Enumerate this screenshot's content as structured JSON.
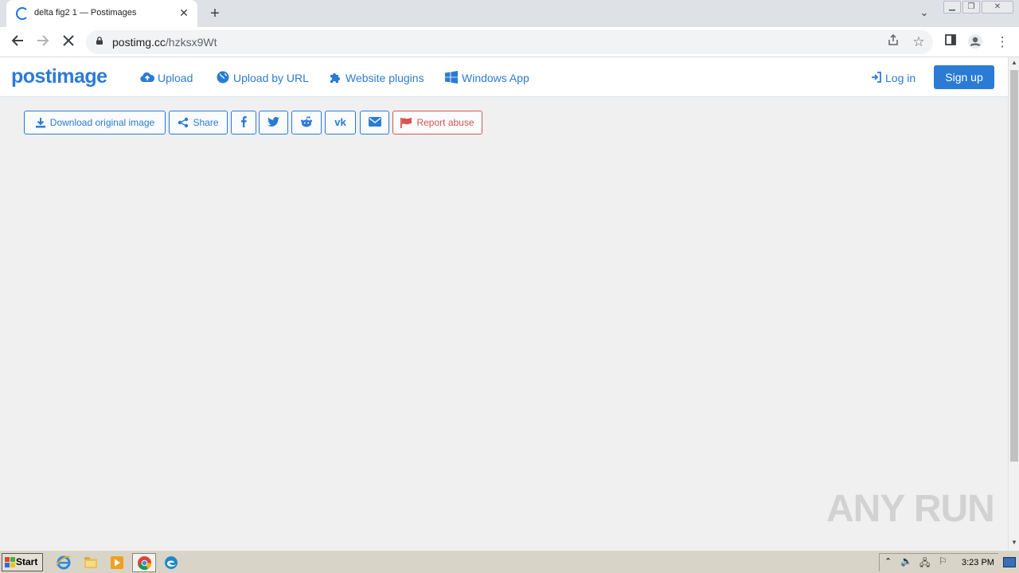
{
  "browser": {
    "tab_title": "delta fig2 1 — Postimages",
    "url_host": "postimg.cc",
    "url_path": "/hzksx9Wt"
  },
  "site": {
    "logo_text": "postimage",
    "nav": {
      "upload": "Upload",
      "upload_by_url": "Upload by URL",
      "website_plugins": "Website plugins",
      "windows_app": "Windows App",
      "log_in": "Log in",
      "sign_up": "Sign up"
    },
    "actions": {
      "download": "Download original image",
      "share": "Share",
      "report": "Report abuse"
    },
    "colors": {
      "accent": "#2b7bd6",
      "report": "#d9534f"
    }
  },
  "watermark": "ANY RUN",
  "taskbar": {
    "start_label": "Start",
    "clock": "3:23 PM"
  }
}
